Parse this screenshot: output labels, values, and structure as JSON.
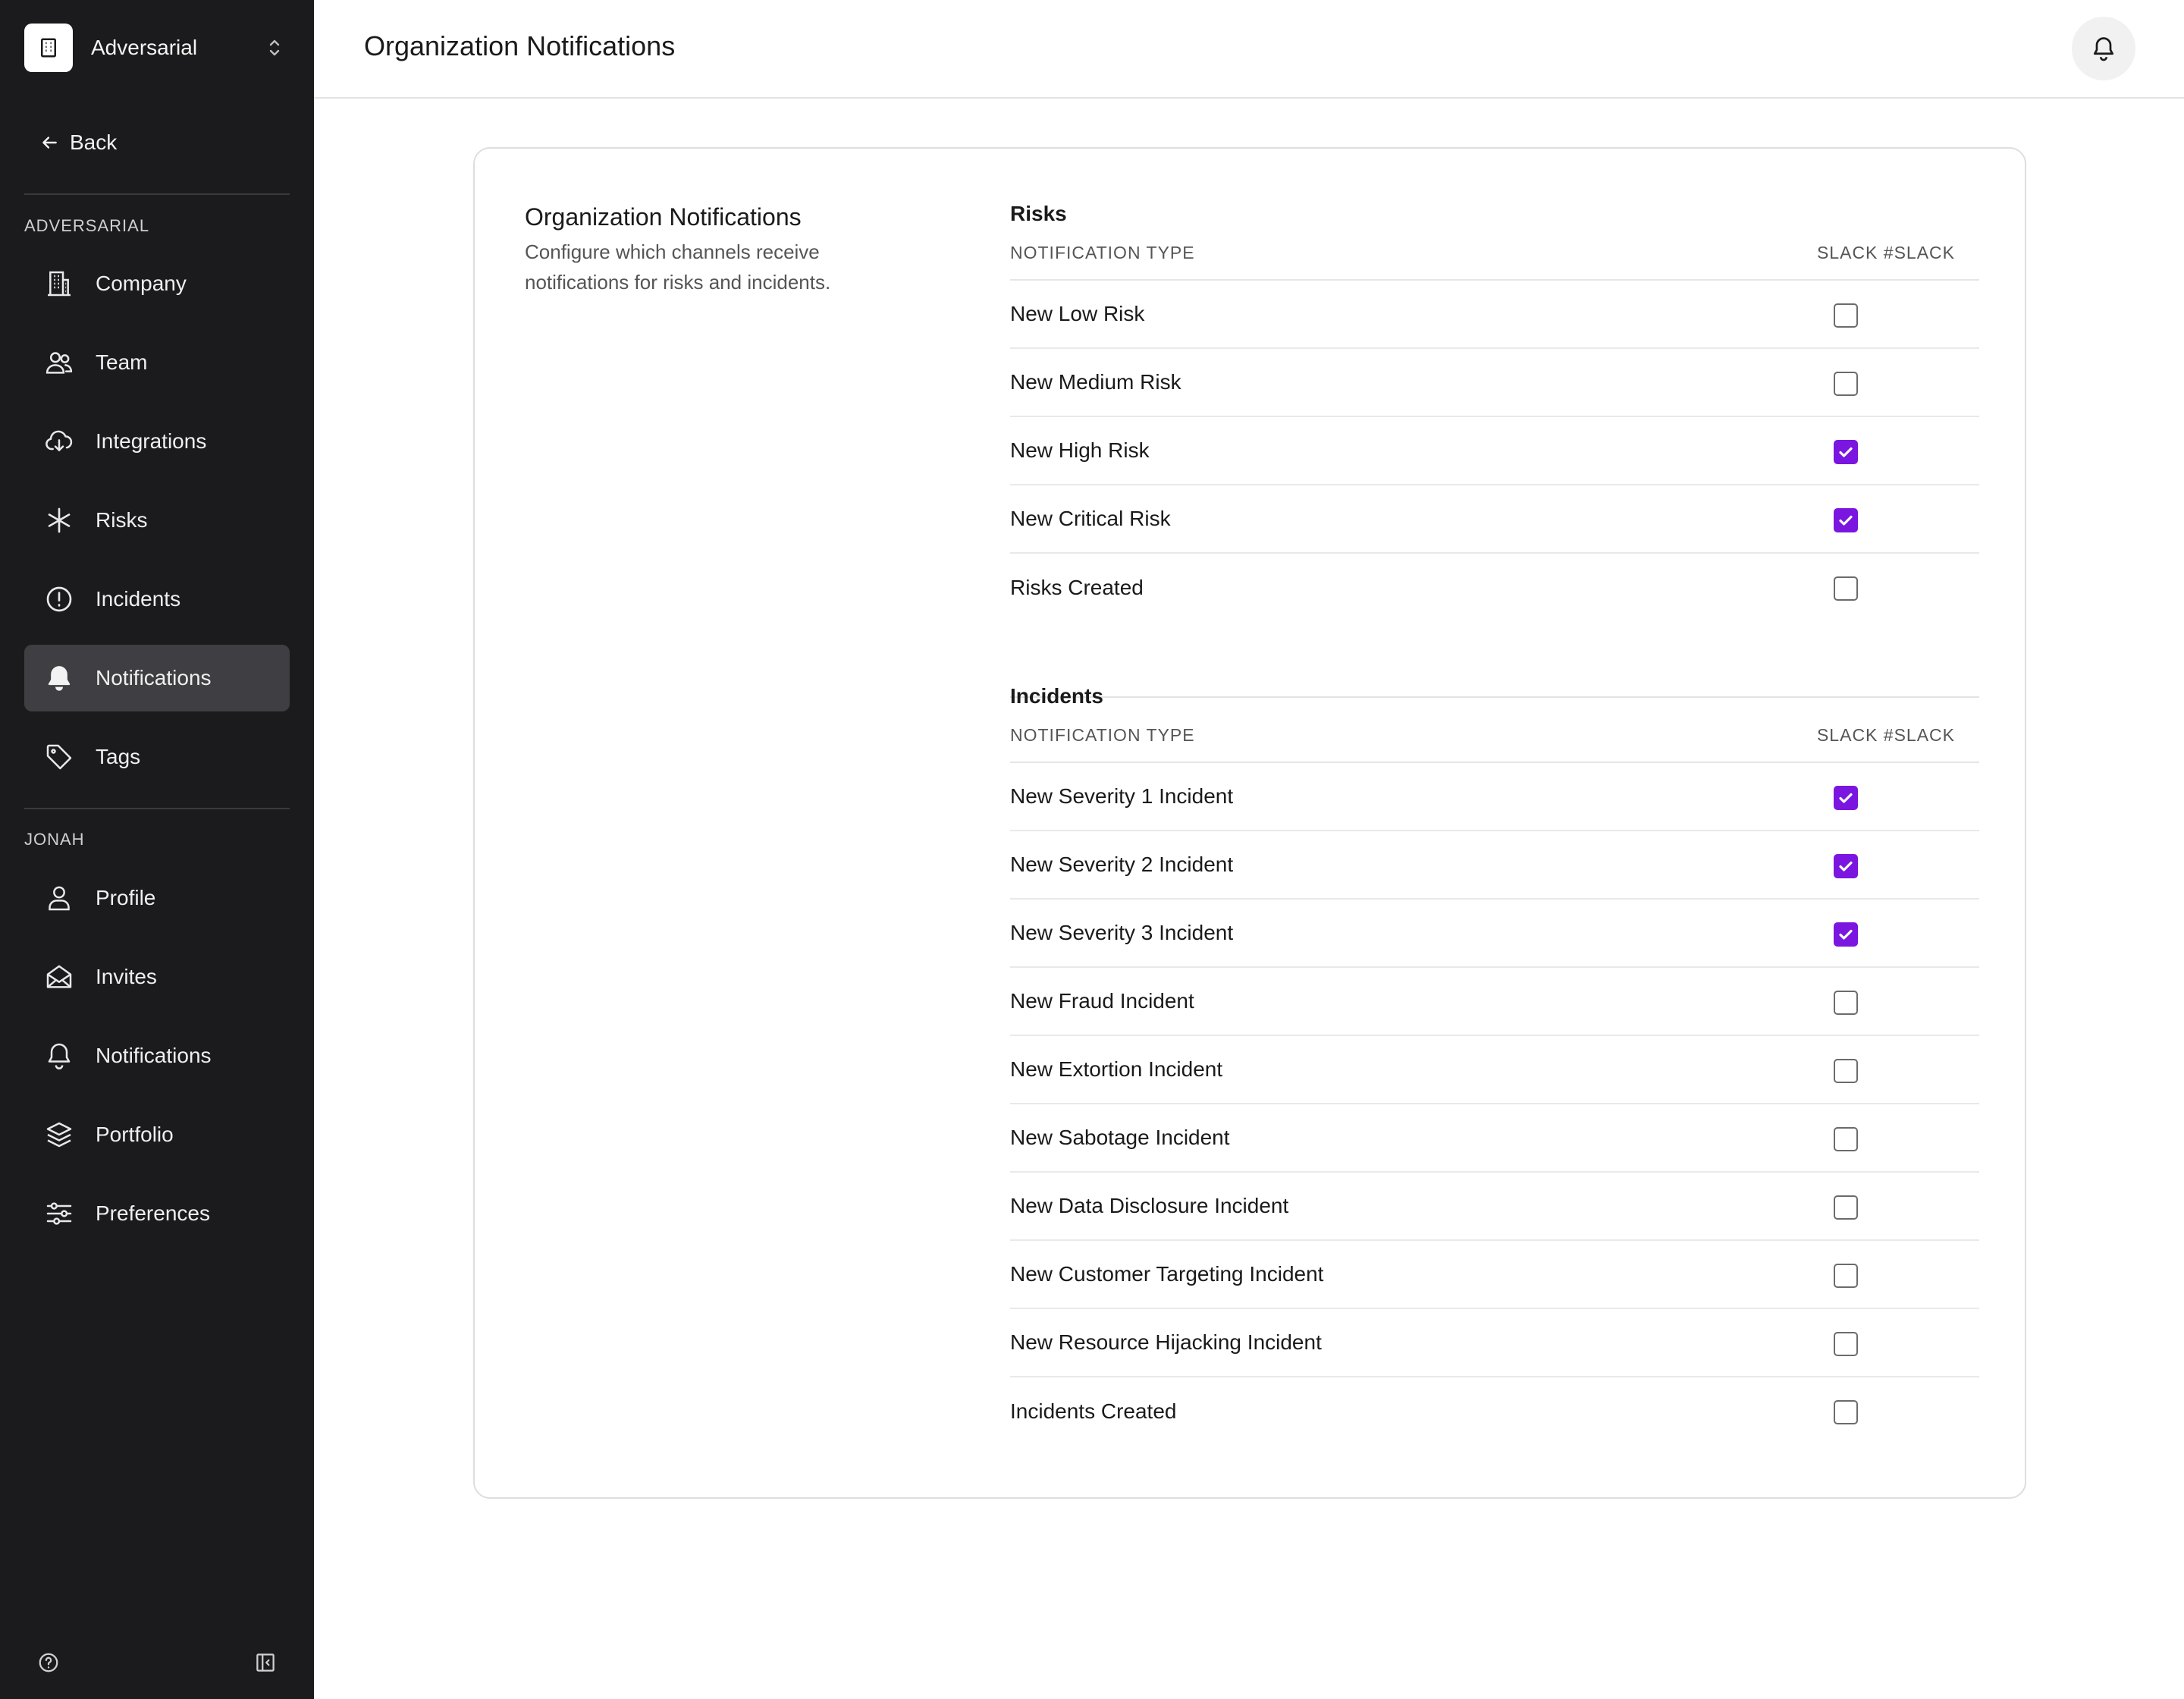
{
  "colors": {
    "sidebar_bg": "#1b1b1d",
    "accent": "#7a16e0",
    "active_nav": "#3f3f43"
  },
  "sidebar": {
    "org_name": "Adversarial",
    "back_label": "Back",
    "sections": [
      {
        "label": "ADVERSARIAL",
        "items": [
          {
            "label": "Company",
            "icon": "building-icon"
          },
          {
            "label": "Team",
            "icon": "users-icon"
          },
          {
            "label": "Integrations",
            "icon": "cloud-download-icon"
          },
          {
            "label": "Risks",
            "icon": "asterisk-icon"
          },
          {
            "label": "Incidents",
            "icon": "alert-circle-icon"
          },
          {
            "label": "Notifications",
            "icon": "bell-filled-icon",
            "active": true
          },
          {
            "label": "Tags",
            "icon": "tag-icon"
          }
        ]
      },
      {
        "label": "JONAH",
        "items": [
          {
            "label": "Profile",
            "icon": "user-icon"
          },
          {
            "label": "Invites",
            "icon": "mail-open-icon"
          },
          {
            "label": "Notifications",
            "icon": "bell-icon"
          },
          {
            "label": "Portfolio",
            "icon": "layers-icon"
          },
          {
            "label": "Preferences",
            "icon": "sliders-icon"
          }
        ]
      }
    ]
  },
  "header": {
    "title": "Organization Notifications"
  },
  "card": {
    "title": "Organization Notifications",
    "description": "Configure which channels receive notifications for risks and incidents.",
    "groups": [
      {
        "title": "Risks",
        "col_type": "NOTIFICATION TYPE",
        "col_channel": "SLACK #SLACK",
        "rows": [
          {
            "label": "New Low Risk",
            "checked": false
          },
          {
            "label": "New Medium Risk",
            "checked": false
          },
          {
            "label": "New High Risk",
            "checked": true
          },
          {
            "label": "New Critical Risk",
            "checked": true
          },
          {
            "label": "Risks Created",
            "checked": false
          }
        ]
      },
      {
        "title": "Incidents",
        "col_type": "NOTIFICATION TYPE",
        "col_channel": "SLACK #SLACK",
        "rows": [
          {
            "label": "New Severity 1 Incident",
            "checked": true
          },
          {
            "label": "New Severity 2 Incident",
            "checked": true
          },
          {
            "label": "New Severity 3 Incident",
            "checked": true
          },
          {
            "label": "New Fraud Incident",
            "checked": false
          },
          {
            "label": "New Extortion Incident",
            "checked": false
          },
          {
            "label": "New Sabotage Incident",
            "checked": false
          },
          {
            "label": "New Data Disclosure Incident",
            "checked": false
          },
          {
            "label": "New Customer Targeting Incident",
            "checked": false
          },
          {
            "label": "New Resource Hijacking Incident",
            "checked": false
          },
          {
            "label": "Incidents Created",
            "checked": false
          }
        ]
      }
    ]
  }
}
